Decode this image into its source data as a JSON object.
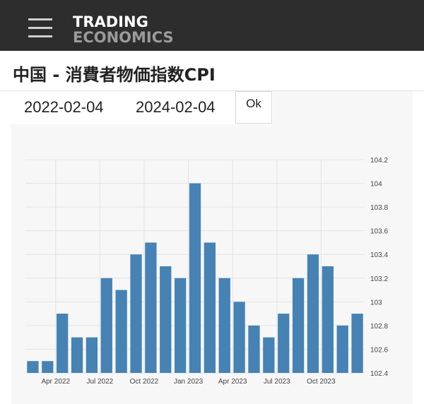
{
  "header": {
    "logo_line1": "TRADING",
    "logo_line2": "ECONOMICS",
    "menu_icon": "hamburger-menu-icon"
  },
  "page": {
    "title": "中国 - 消費者物価指数CPI"
  },
  "date_range": {
    "start": "2022-02-04",
    "end": "2024-02-04",
    "ok_label": "Ok"
  },
  "colors": {
    "topbar": "#2d2d2d",
    "bar": "#4682b4",
    "panel": "#f7f7f7"
  },
  "chart_data": {
    "type": "bar",
    "title": "",
    "xlabel": "",
    "ylabel": "",
    "ylim": [
      102.4,
      104.2
    ],
    "yticks": [
      "104.2",
      "104",
      "103.8",
      "103.6",
      "103.4",
      "103.2",
      "103",
      "102.8",
      "102.6",
      "102.4"
    ],
    "x_tick_labels": [
      {
        "label": "Apr 2022",
        "index": 2
      },
      {
        "label": "Jul 2022",
        "index": 5
      },
      {
        "label": "Oct 2022",
        "index": 8
      },
      {
        "label": "Jan 2023",
        "index": 11
      },
      {
        "label": "Apr 2023",
        "index": 14
      },
      {
        "label": "Jul 2023",
        "index": 17
      },
      {
        "label": "Oct 2023",
        "index": 20
      }
    ],
    "categories": [
      "2022-02",
      "2022-03",
      "2022-04",
      "2022-05",
      "2022-06",
      "2022-07",
      "2022-08",
      "2022-09",
      "2022-10",
      "2022-11",
      "2022-12",
      "2023-01",
      "2023-02",
      "2023-03",
      "2023-04",
      "2023-05",
      "2023-06",
      "2023-07",
      "2023-08",
      "2023-09",
      "2023-10",
      "2023-11",
      "2023-12"
    ],
    "values": [
      102.5,
      102.5,
      102.9,
      102.7,
      102.7,
      103.2,
      103.1,
      103.4,
      103.5,
      103.3,
      103.2,
      104.0,
      103.5,
      103.2,
      103.0,
      102.8,
      102.7,
      102.9,
      103.2,
      103.4,
      103.3,
      102.8,
      102.9
    ],
    "grid": true,
    "legend": "none",
    "y_axis_position": "right"
  }
}
